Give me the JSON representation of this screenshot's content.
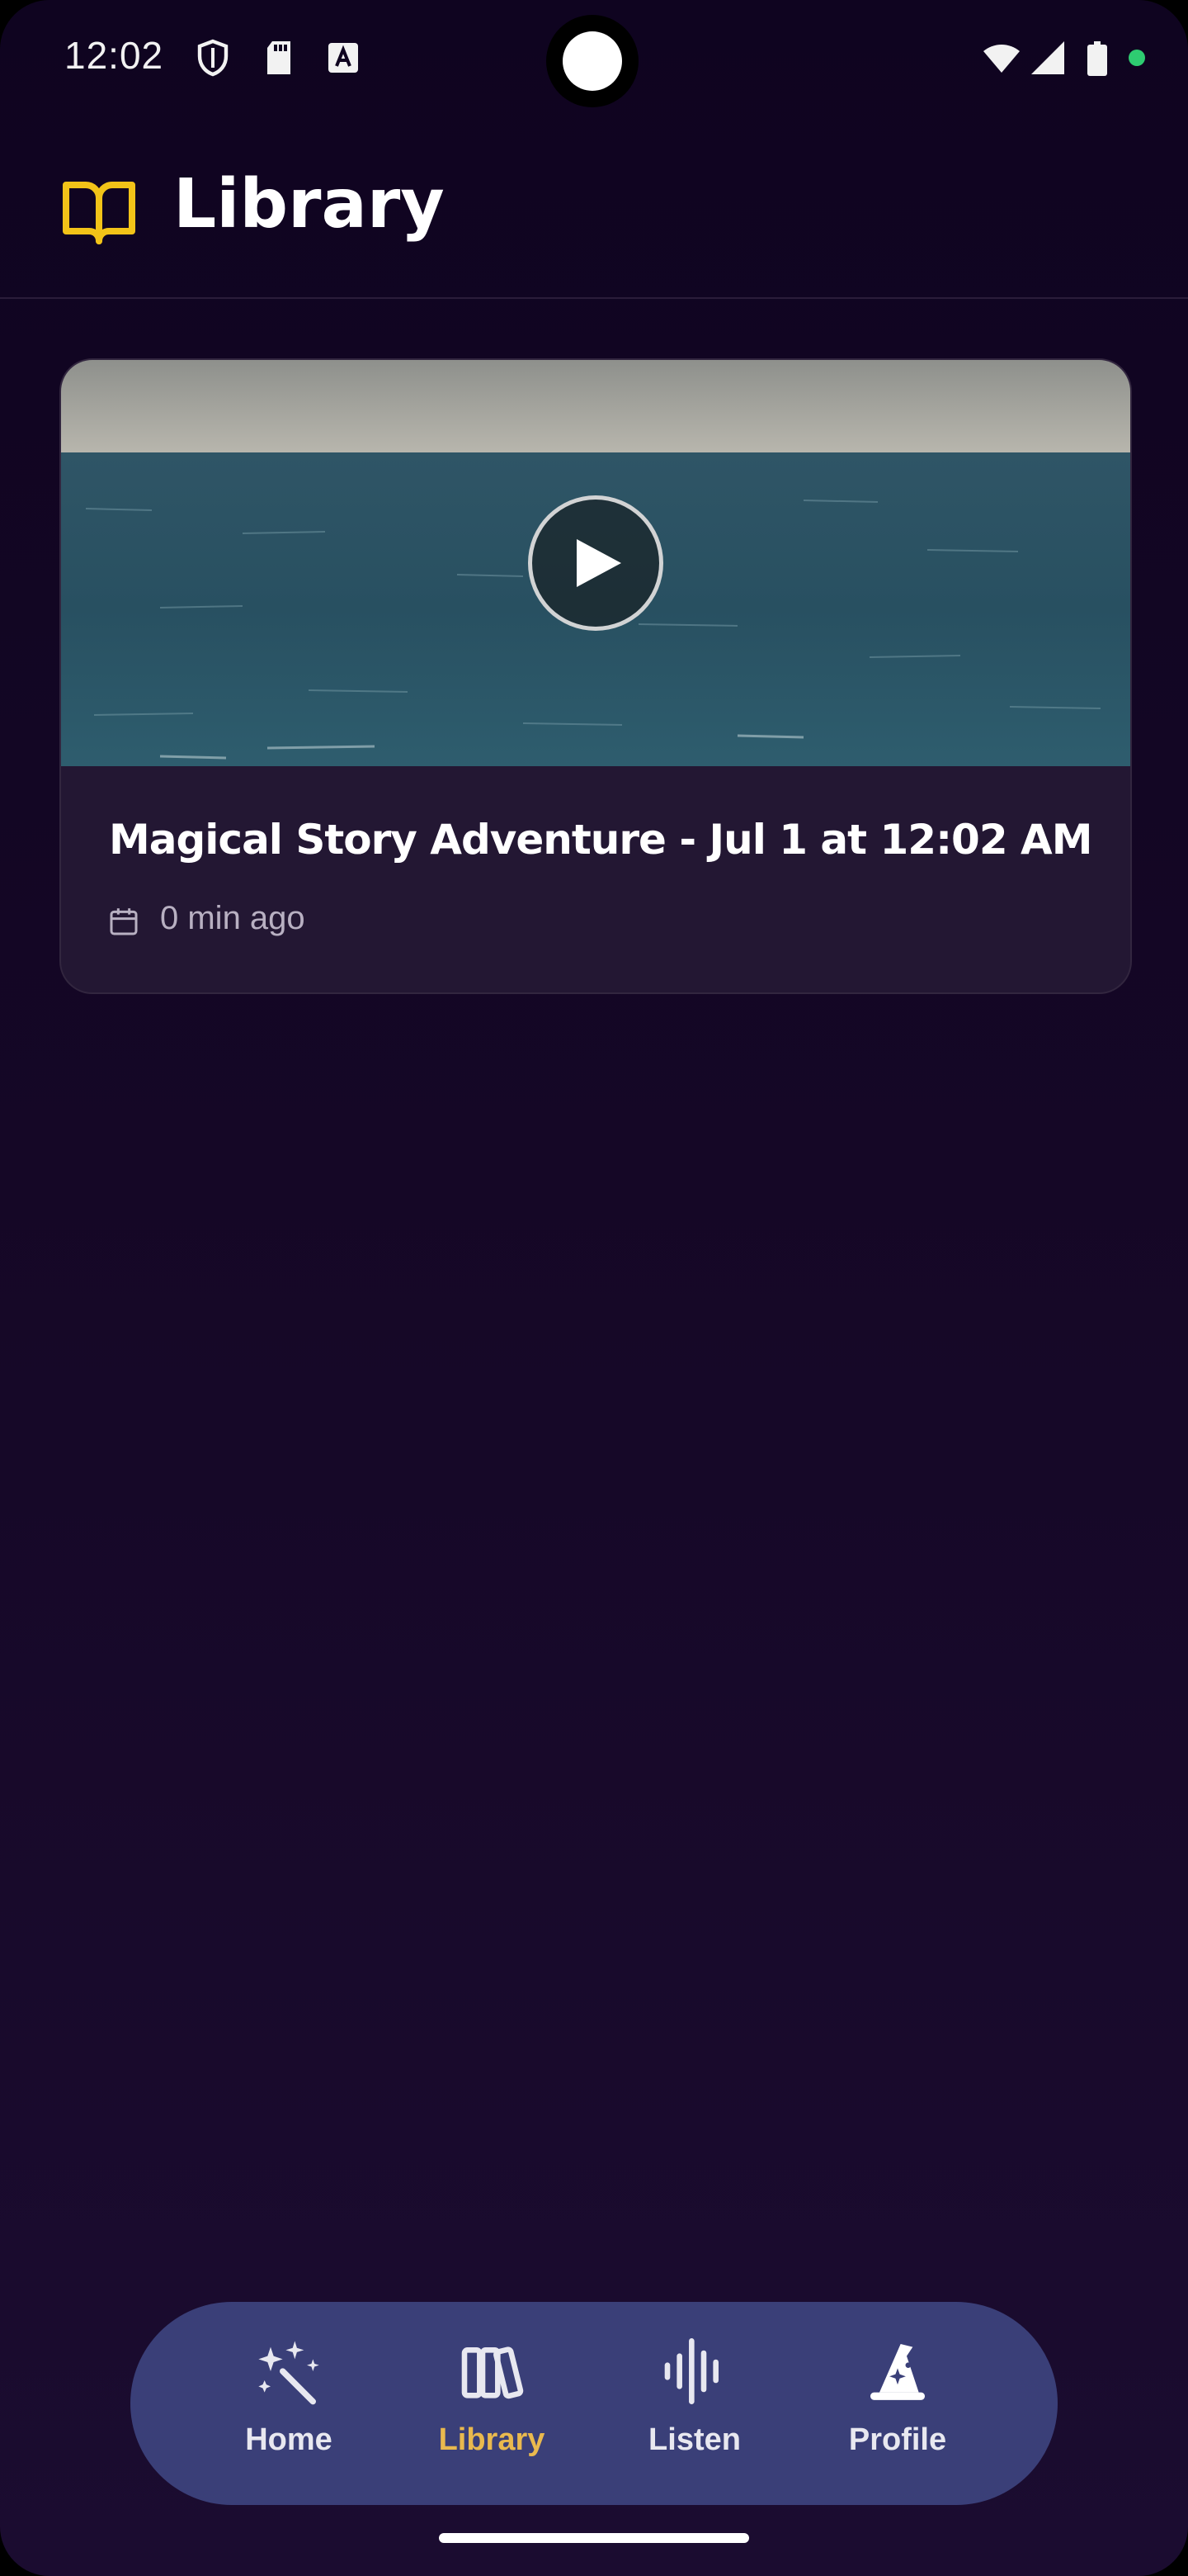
{
  "status_bar": {
    "time": "12:02"
  },
  "header": {
    "title": "Library"
  },
  "stories": [
    {
      "title": "Magical Story Adventure - Jul 1 at 12:02 AM",
      "time_ago": "0 min ago"
    }
  ],
  "nav": {
    "items": [
      {
        "label": "Home",
        "icon": "magic-wand-icon"
      },
      {
        "label": "Library",
        "icon": "books-icon",
        "active": true
      },
      {
        "label": "Listen",
        "icon": "sound-wave-icon"
      },
      {
        "label": "Profile",
        "icon": "wizard-hat-icon"
      }
    ]
  },
  "colors": {
    "background": "#130625",
    "accent_yellow": "#f2c318",
    "active_nav": "#e9b94e",
    "nav_background": "#3a3f78",
    "card_background": "#231733"
  }
}
